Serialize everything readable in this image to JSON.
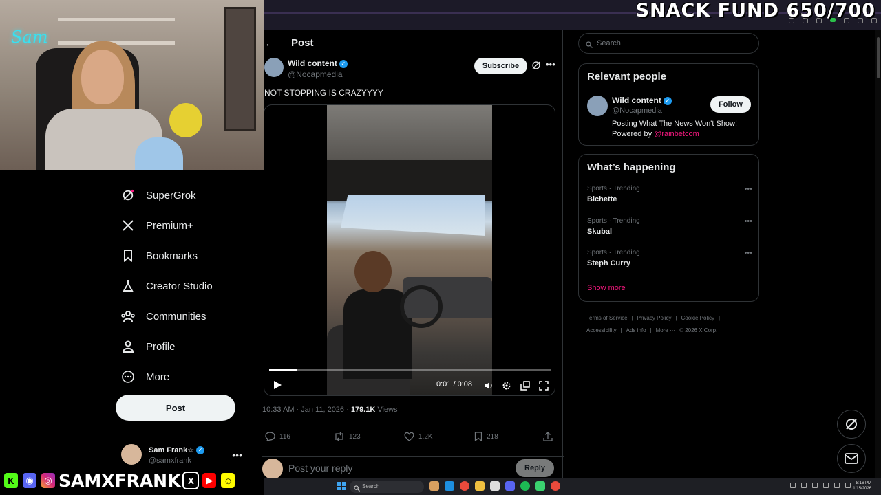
{
  "overlay": {
    "snack_fund": "SNACK FUND 650/700",
    "webcam_neon": "Sam",
    "handle": "SAMXFRANK"
  },
  "nav": {
    "items": [
      {
        "label": "SuperGrok",
        "icon": "grok-icon"
      },
      {
        "label": "Premium+",
        "icon": "x-logo-icon"
      },
      {
        "label": "Bookmarks",
        "icon": "bookmark-icon"
      },
      {
        "label": "Creator Studio",
        "icon": "creator-studio-icon"
      },
      {
        "label": "Communities",
        "icon": "communities-icon"
      },
      {
        "label": "Profile",
        "icon": "profile-icon"
      },
      {
        "label": "More",
        "icon": "more-circle-icon"
      }
    ],
    "post_label": "Post"
  },
  "account": {
    "name": "Sam Frank☆",
    "handle": "@samxfrank"
  },
  "post": {
    "header_title": "Post",
    "author_name": "Wild content",
    "author_handle": "@Nocapmedia",
    "subscribe_label": "Subscribe",
    "text": "NOT STOPPING IS CRAZYYYY",
    "video": {
      "time": "0:01 / 0:08",
      "progress": 0.1
    },
    "timestamp": "10:33 AM · Jan 11, 2026 · ",
    "views_count": "179.1K",
    "views_label": " Views",
    "replies": "116",
    "reposts": "123",
    "likes": "1.2K",
    "bookmarks": "218",
    "reply_placeholder": "Post your reply",
    "reply_label": "Reply"
  },
  "sidebar": {
    "search_placeholder": "Search",
    "relevant_title": "Relevant people",
    "relevant": {
      "name": "Wild content",
      "handle": "@Nocapmedia",
      "follow_label": "Follow",
      "bio": "Posting What The News Won't Show!",
      "bio_powered": "Powered by ",
      "bio_link": "@rainbetcom"
    },
    "happening_title": "What’s happening",
    "trends": [
      {
        "category": "Sports · Trending",
        "title": "Bichette"
      },
      {
        "category": "Sports · Trending",
        "title": "Skubal"
      },
      {
        "category": "Sports · Trending",
        "title": "Steph Curry"
      }
    ],
    "show_more": "Show more",
    "footer": [
      "Terms of Service",
      "|",
      "Privacy Policy",
      "|",
      "Cookie Policy",
      "|",
      "Accessibility",
      "|",
      "Ads info",
      "|",
      "More ···",
      "© 2026 X Corp."
    ]
  },
  "taskbar": {
    "search_placeholder": "Search",
    "time": "8:16 PM",
    "date": "1/15/2026"
  }
}
